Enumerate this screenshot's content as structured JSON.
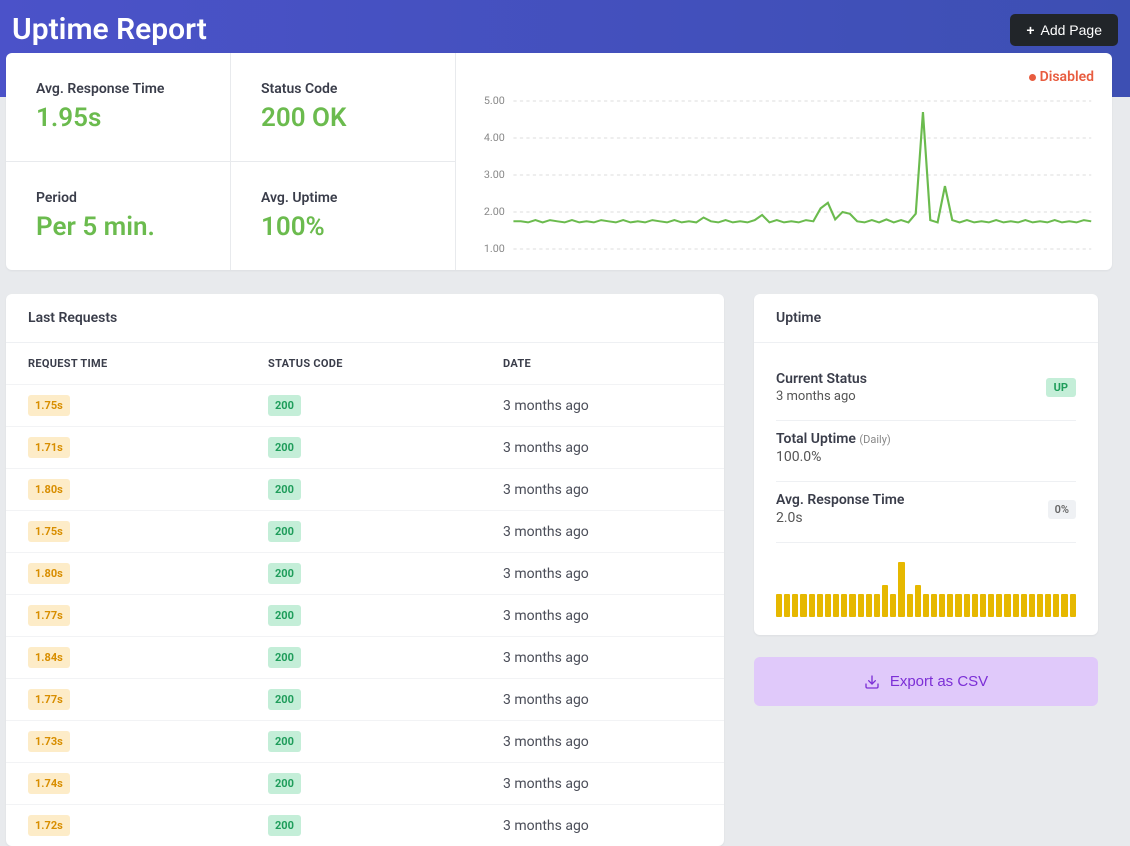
{
  "header": {
    "title": "Uptime Report",
    "add_page_label": "Add Page"
  },
  "stats": {
    "avg_response_label": "Avg. Response Time",
    "avg_response_value": "1.95s",
    "status_code_label": "Status Code",
    "status_code_value": "200 OK",
    "period_label": "Period",
    "period_value": "Per 5 min.",
    "avg_uptime_label": "Avg. Uptime",
    "avg_uptime_value": "100%"
  },
  "chart_status": "Disabled",
  "chart_data": {
    "type": "line",
    "title": "",
    "xlabel": "",
    "ylabel": "",
    "ylim": [
      1.0,
      5.0
    ],
    "y_ticks": [
      "5.00",
      "4.00",
      "3.00",
      "2.00",
      "1.00"
    ],
    "values": [
      1.75,
      1.75,
      1.72,
      1.78,
      1.72,
      1.78,
      1.75,
      1.72,
      1.78,
      1.72,
      1.75,
      1.72,
      1.78,
      1.75,
      1.72,
      1.78,
      1.72,
      1.75,
      1.72,
      1.78,
      1.75,
      1.72,
      1.78,
      1.72,
      1.75,
      1.72,
      1.85,
      1.75,
      1.72,
      1.78,
      1.72,
      1.75,
      1.72,
      1.78,
      1.92,
      1.72,
      1.78,
      1.72,
      1.75,
      1.72,
      1.78,
      1.75,
      2.1,
      2.25,
      1.8,
      2.0,
      1.95,
      1.75,
      1.72,
      1.78,
      1.72,
      1.8,
      1.72,
      1.78,
      1.72,
      1.95,
      4.7,
      1.78,
      1.72,
      2.7,
      1.78,
      1.72,
      1.78,
      1.72,
      1.75,
      1.72,
      1.78,
      1.72,
      1.75,
      1.72,
      1.78,
      1.72,
      1.75,
      1.72,
      1.78,
      1.72,
      1.75,
      1.72,
      1.78,
      1.75
    ]
  },
  "last_requests": {
    "title": "Last Requests",
    "col_request_time": "REQUEST TIME",
    "col_status_code": "STATUS CODE",
    "col_date": "DATE",
    "rows": [
      {
        "time": "1.75s",
        "status": "200",
        "date": "3 months ago"
      },
      {
        "time": "1.71s",
        "status": "200",
        "date": "3 months ago"
      },
      {
        "time": "1.80s",
        "status": "200",
        "date": "3 months ago"
      },
      {
        "time": "1.75s",
        "status": "200",
        "date": "3 months ago"
      },
      {
        "time": "1.80s",
        "status": "200",
        "date": "3 months ago"
      },
      {
        "time": "1.77s",
        "status": "200",
        "date": "3 months ago"
      },
      {
        "time": "1.84s",
        "status": "200",
        "date": "3 months ago"
      },
      {
        "time": "1.77s",
        "status": "200",
        "date": "3 months ago"
      },
      {
        "time": "1.73s",
        "status": "200",
        "date": "3 months ago"
      },
      {
        "time": "1.74s",
        "status": "200",
        "date": "3 months ago"
      },
      {
        "time": "1.72s",
        "status": "200",
        "date": "3 months ago"
      }
    ]
  },
  "uptime_card": {
    "title": "Uptime",
    "current_status_label": "Current Status",
    "current_status_sub": "3 months ago",
    "current_status_badge": "UP",
    "total_uptime_label": "Total Uptime",
    "total_uptime_suffix": "(Daily)",
    "total_uptime_value": "100.0%",
    "avg_response_label": "Avg. Response Time",
    "avg_response_value": "2.0s",
    "avg_response_badge": "0%",
    "bar_chart": {
      "type": "bar",
      "title": "",
      "xlabel": "",
      "ylabel": "",
      "ylim": [
        0,
        60
      ],
      "values": [
        22,
        22,
        22,
        22,
        22,
        22,
        22,
        22,
        22,
        22,
        22,
        22,
        22,
        30,
        22,
        52,
        22,
        30,
        22,
        22,
        22,
        22,
        22,
        22,
        22,
        22,
        22,
        22,
        22,
        22,
        22,
        22,
        22,
        22,
        22,
        22,
        22
      ]
    }
  },
  "export_label": "Export as CSV"
}
